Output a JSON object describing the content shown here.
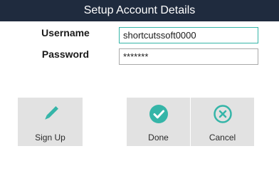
{
  "window": {
    "title": "Setup Account Details"
  },
  "form": {
    "username_label": "Username",
    "username_value": "shortcutssoft0000",
    "password_label": "Password",
    "password_value": "*******"
  },
  "buttons": {
    "sign_up": {
      "label": "Sign Up",
      "icon": "pencil-icon"
    },
    "done": {
      "label": "Done",
      "icon": "check-circle-icon"
    },
    "cancel": {
      "label": "Cancel",
      "icon": "x-circle-icon"
    }
  },
  "colors": {
    "titlebar": "#1f2b3e",
    "accent": "#35b5a8",
    "button_bg": "#e2e2e2"
  }
}
